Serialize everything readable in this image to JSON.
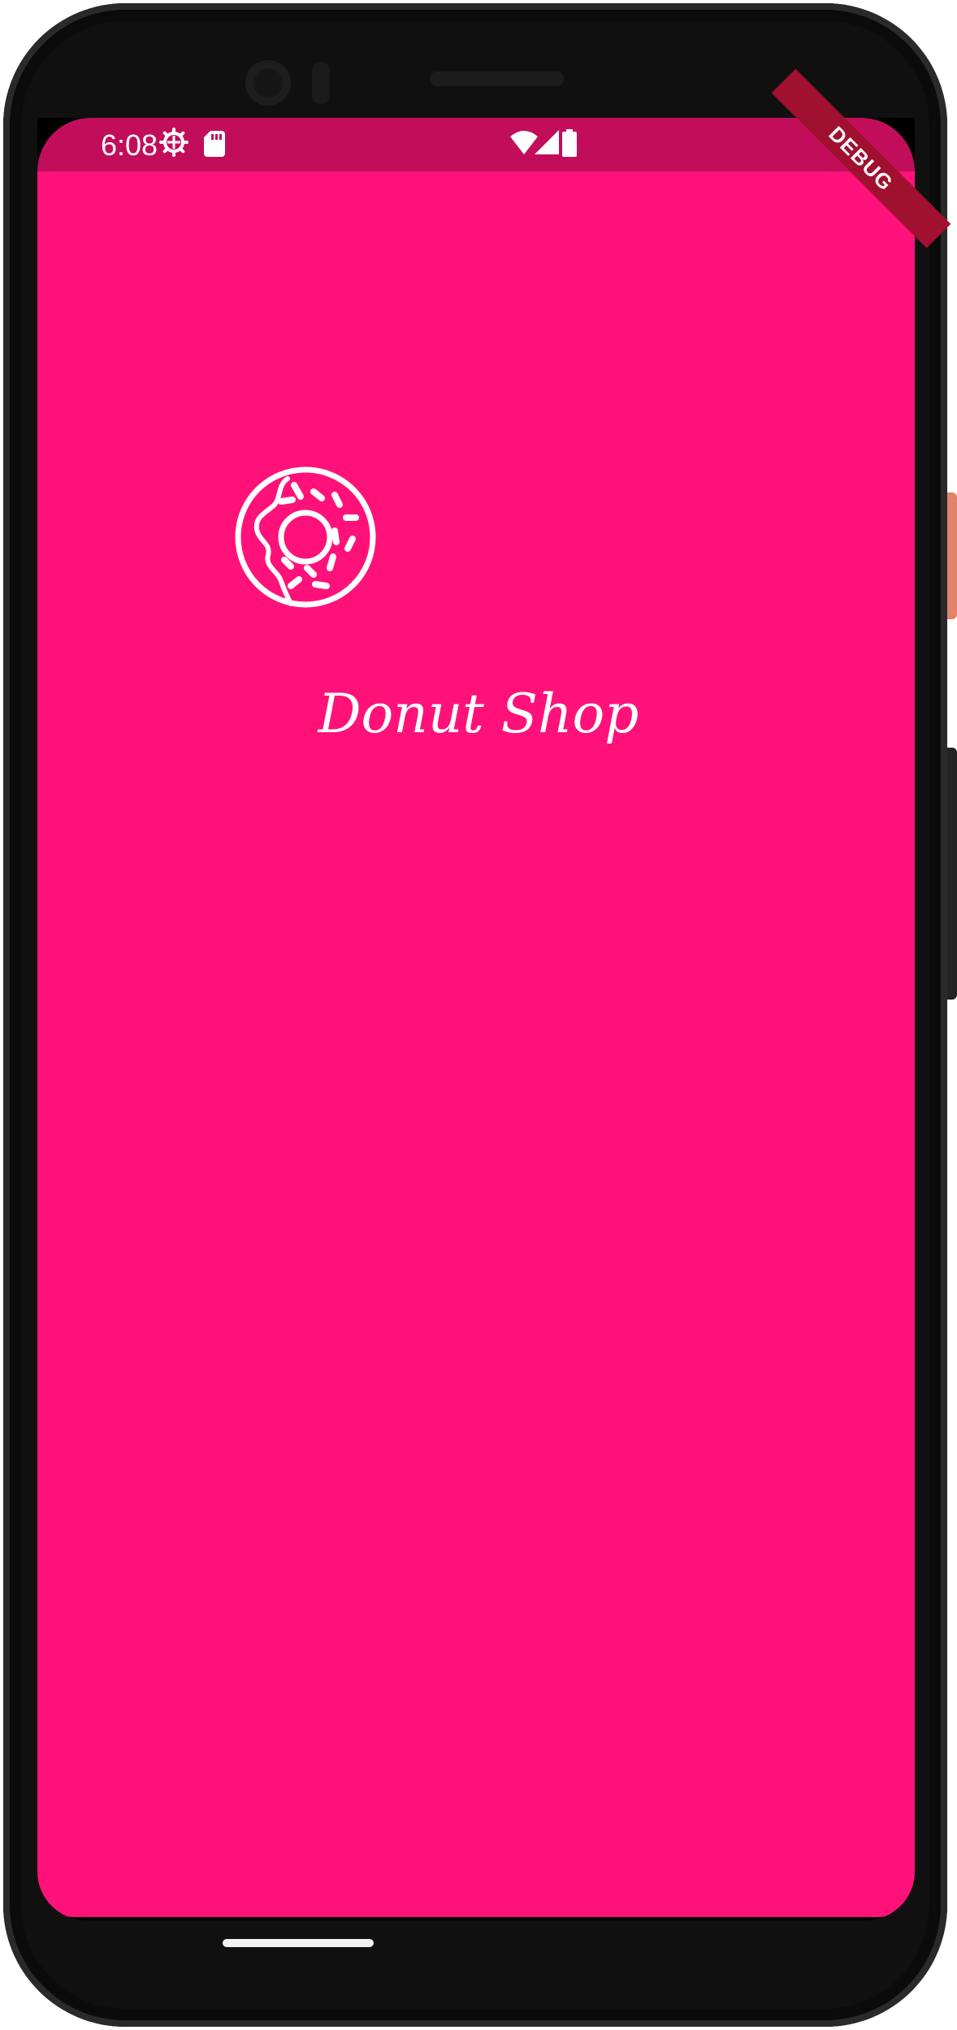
{
  "status_bar": {
    "time": "6:08",
    "icons": [
      "settings-gear-icon",
      "sdcard-icon",
      "wifi-icon",
      "signal-icon",
      "battery-icon"
    ]
  },
  "debug_banner": {
    "label": "DEBUG"
  },
  "app": {
    "logo": "donut-icon",
    "title": "Donut Shop"
  },
  "colors": {
    "background": "#ff117a",
    "status_bar": "#c20e5a",
    "foreground": "#ffffff",
    "debug_banner": "#a0102f"
  }
}
